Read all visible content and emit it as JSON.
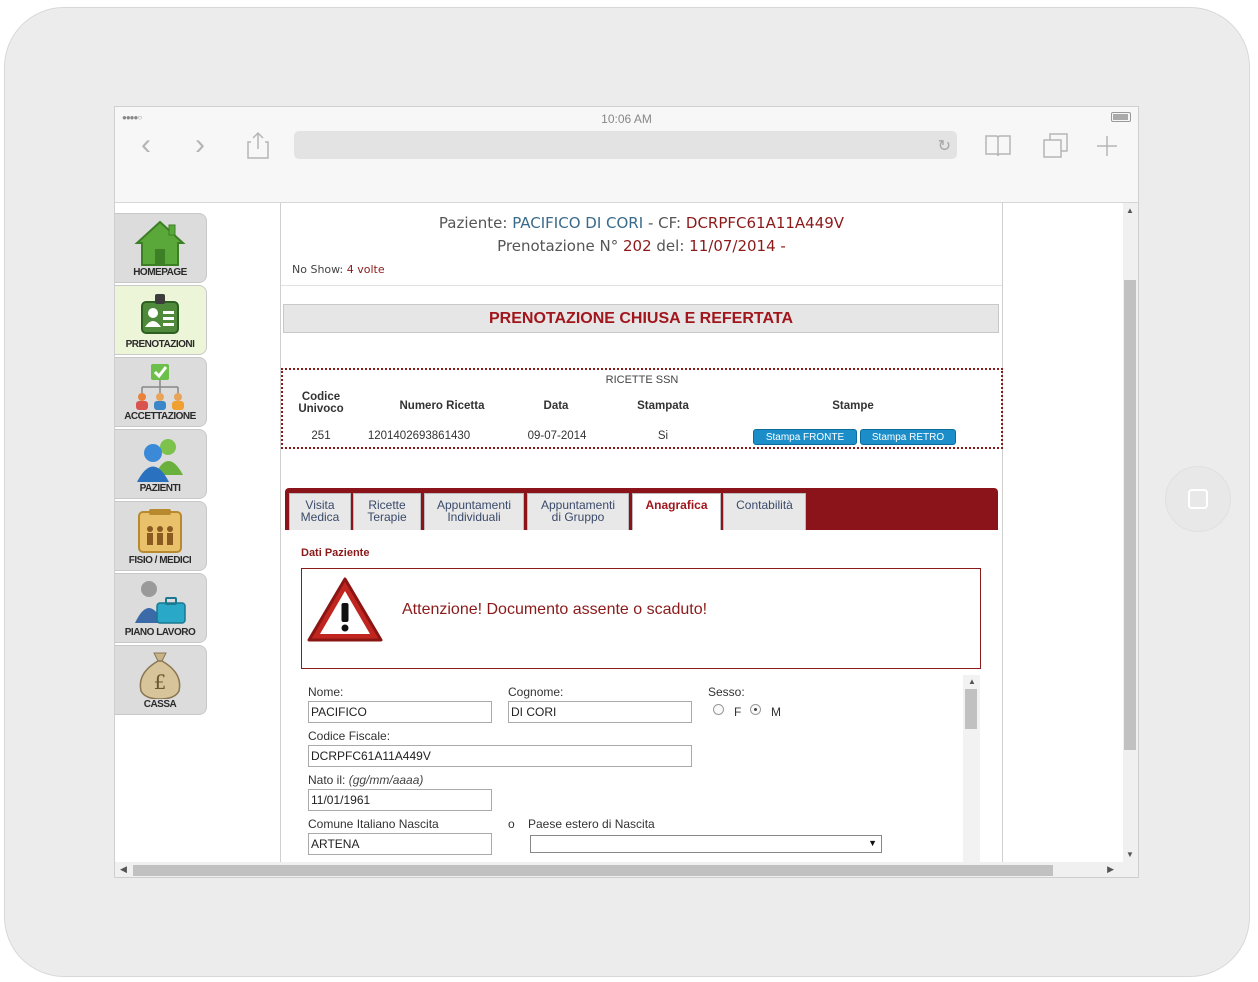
{
  "browser": {
    "time": "10:06 AM",
    "signal": "●●●●○"
  },
  "sidebar": {
    "items": [
      {
        "label": "HOMEPAGE",
        "icon": "home-icon"
      },
      {
        "label": "PRENOTAZIONI",
        "icon": "id-badge-icon"
      },
      {
        "label": "ACCETTAZIONE",
        "icon": "org-chart-icon"
      },
      {
        "label": "PAZIENTI",
        "icon": "users-icon"
      },
      {
        "label": "FISIO / MEDICI",
        "icon": "staff-icon"
      },
      {
        "label": "PIANO LAVORO",
        "icon": "briefcase-icon"
      },
      {
        "label": "CASSA",
        "icon": "money-bag-icon"
      }
    ],
    "active": "PRENOTAZIONI"
  },
  "header": {
    "paziente_label": "Paziente:",
    "paziente_name": "PACIFICO DI CORI",
    "cf_label": "- CF:",
    "cf_value": "DCRPFC61A11A449V",
    "prenotazione_label": "Prenotazione N°",
    "prenotazione_number": "202",
    "del_label": "del:",
    "date": "11/07/2014",
    "dash": "-",
    "noshow_label": "No Show:",
    "noshow_value": "4 volte"
  },
  "status_banner": "PRENOTAZIONE CHIUSA E REFERTATA",
  "ricette": {
    "title": "RICETTE SSN",
    "headers": {
      "codice_1": "Codice",
      "codice_2": "Univoco",
      "numero": "Numero Ricetta",
      "data": "Data",
      "stampata": "Stampata",
      "stampe": "Stampe"
    },
    "row": {
      "codice": "251",
      "numero": "1201402693861430",
      "data": "09-07-2014",
      "stampata": "Si"
    },
    "btn_fronte": "Stampa FRONTE",
    "btn_retro": "Stampa RETRO"
  },
  "tabs": [
    {
      "line1": "Visita",
      "line2": "Medica"
    },
    {
      "line1": "Ricette",
      "line2": "Terapie"
    },
    {
      "line1": "Appuntamenti",
      "line2": "Individuali"
    },
    {
      "line1": "Appuntamenti",
      "line2": "di Gruppo"
    },
    {
      "line1": "Anagrafica",
      "line2": ""
    },
    {
      "line1": "Contabilità",
      "line2": ""
    }
  ],
  "active_tab": "Anagrafica",
  "section_title": "Dati Paziente",
  "alert": {
    "text": "Attenzione! Documento assente o scaduto!",
    "icon": "warning-icon"
  },
  "form": {
    "nome_label": "Nome:",
    "nome_value": "PACIFICO",
    "cognome_label": "Cognome:",
    "cognome_value": "DI CORI",
    "sesso_label": "Sesso:",
    "sesso_f": "F",
    "sesso_m": "M",
    "sesso_selected": "M",
    "cf_label": "Codice Fiscale:",
    "cf_value": "DCRPFC61A11A449V",
    "nato_label": "Nato il:",
    "nato_hint": "(gg/mm/aaaa)",
    "nato_value": "11/01/1961",
    "comune_label": "Comune Italiano Nascita",
    "o_label": "o",
    "paese_label": "Paese estero di Nascita",
    "comune_value": "ARTENA",
    "paese_value": ""
  },
  "colors": {
    "accent_red": "#8b1a1a",
    "banner_red": "#a0161c",
    "button_blue": "#1b8ec9",
    "active_sidebar": "#edf5d8"
  }
}
